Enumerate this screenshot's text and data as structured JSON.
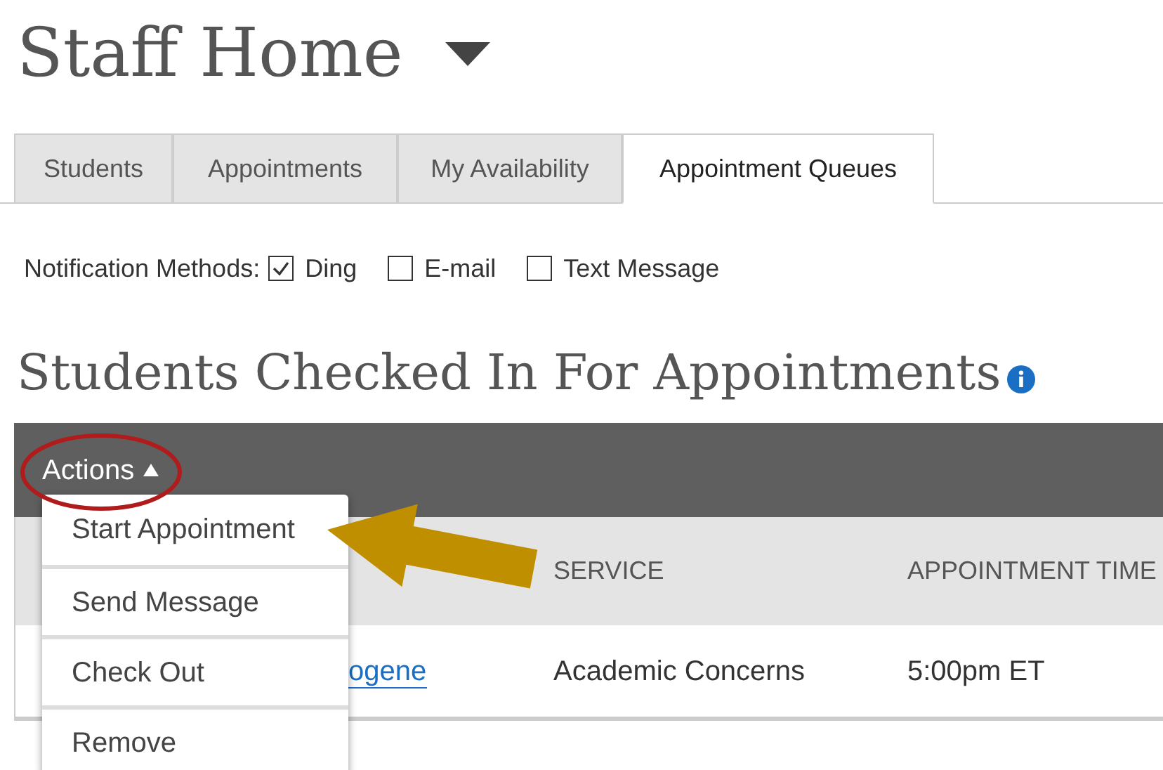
{
  "page_title": "Staff Home",
  "tabs": [
    {
      "label": "Students",
      "selected": false
    },
    {
      "label": "Appointments",
      "selected": false
    },
    {
      "label": "My Availability",
      "selected": false
    },
    {
      "label": "Appointment Queues",
      "selected": true
    }
  ],
  "notification_methods": {
    "label": "Notification Methods:",
    "options": [
      {
        "label": "Ding",
        "checked": true
      },
      {
        "label": "E-mail",
        "checked": false
      },
      {
        "label": "Text Message",
        "checked": false
      }
    ]
  },
  "section_heading": "Students Checked In For Appointments",
  "actions_button": {
    "label": "Actions",
    "expanded": true
  },
  "actions_menu": [
    "Start Appointment",
    "Send Message",
    "Check Out",
    "Remove"
  ],
  "table": {
    "columns": [
      "SERVICE",
      "APPOINTMENT TIME"
    ],
    "rows": [
      {
        "name": "ogene",
        "service": "Academic Concerns",
        "appointment_time": "5:00pm ET"
      }
    ]
  }
}
